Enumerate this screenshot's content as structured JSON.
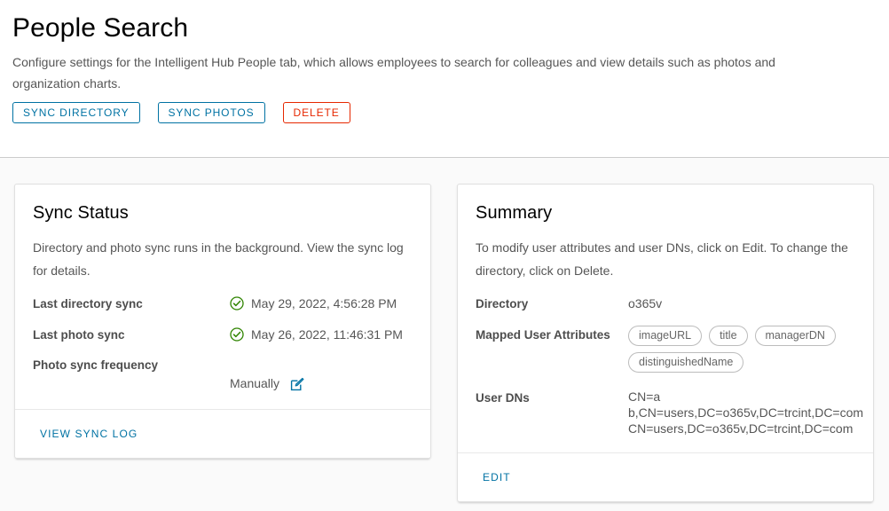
{
  "header": {
    "title": "People Search",
    "description": "Configure settings for the Intelligent Hub People tab, which allows employees to search for colleagues and view details such as photos and organization charts.",
    "buttons": [
      {
        "label": "SYNC DIRECTORY",
        "style": "outline"
      },
      {
        "label": "SYNC PHOTOS",
        "style": "outline"
      },
      {
        "label": "DELETE",
        "style": "danger"
      }
    ]
  },
  "sync_status_card": {
    "title": "Sync Status",
    "description": "Directory and photo sync runs in the background. View the sync log for details.",
    "rows": [
      {
        "label": "Last directory sync",
        "value": "May 29, 2022, 4:56:28 PM",
        "icon": "check-circle-icon",
        "icon_color": "#2f8400"
      },
      {
        "label": "Last photo sync",
        "value": "May 26, 2022, 11:46:31 PM",
        "icon": "check-circle-icon",
        "icon_color": "#2f8400"
      },
      {
        "label": "Photo sync frequency",
        "value": "Manually",
        "icon": "pencil-square-icon",
        "icon_color": "#0072a3"
      }
    ],
    "footer_link": "VIEW SYNC LOG"
  },
  "summary_card": {
    "title": "Summary",
    "description": "To modify user attributes and user DNs, click on Edit. To change the directory, click on Delete.",
    "directory_label": "Directory",
    "directory_value": "o365v",
    "attributes_label": "Mapped User Attributes",
    "attributes": [
      "imageURL",
      "title",
      "managerDN",
      "distinguishedName"
    ],
    "user_dns_label": "User DNs",
    "user_dns": [
      "CN=a",
      "b,CN=users,DC=o365v,DC=trcint,DC=com",
      "CN=users,DC=o365v,DC=trcint,DC=com"
    ],
    "footer_link": "EDIT"
  },
  "colors": {
    "accent": "#0072a3",
    "danger": "#e62700",
    "success": "#2f8400",
    "text": "#565656",
    "label": "#4d4d4d",
    "page_bg": "#fafafa",
    "card_bg": "#ffffff"
  }
}
